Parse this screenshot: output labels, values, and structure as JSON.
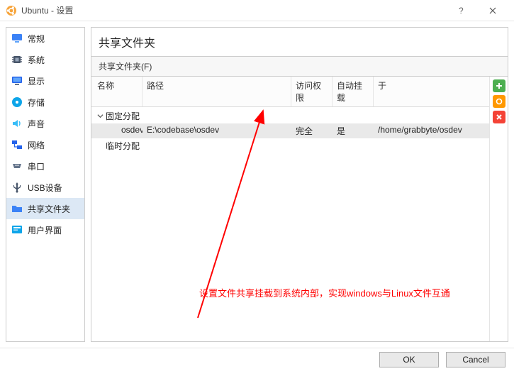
{
  "window": {
    "title": "Ubuntu - 设置"
  },
  "sidebar": {
    "items": [
      {
        "label": "常规"
      },
      {
        "label": "系统"
      },
      {
        "label": "显示"
      },
      {
        "label": "存储"
      },
      {
        "label": "声音"
      },
      {
        "label": "网络"
      },
      {
        "label": "串口"
      },
      {
        "label": "USB设备"
      },
      {
        "label": "共享文件夹"
      },
      {
        "label": "用户界面"
      }
    ]
  },
  "content": {
    "title": "共享文件夹",
    "section_label": "共享文件夹(F)",
    "columns": {
      "name": "名称",
      "path": "路径",
      "access": "访问权限",
      "automount": "自动挂载",
      "at": "于"
    },
    "groups": {
      "fixed": "固定分配",
      "transient": "临时分配"
    },
    "rows": [
      {
        "name": "osdev",
        "path": "E:\\codebase\\osdev",
        "access": "完全",
        "automount": "是",
        "at": "/home/grabbyte/osdev"
      }
    ]
  },
  "annotation": {
    "text": "设置文件共享挂载到系统内部，实现windows与Linux文件互通"
  },
  "footer": {
    "ok": "OK",
    "cancel": "Cancel"
  }
}
